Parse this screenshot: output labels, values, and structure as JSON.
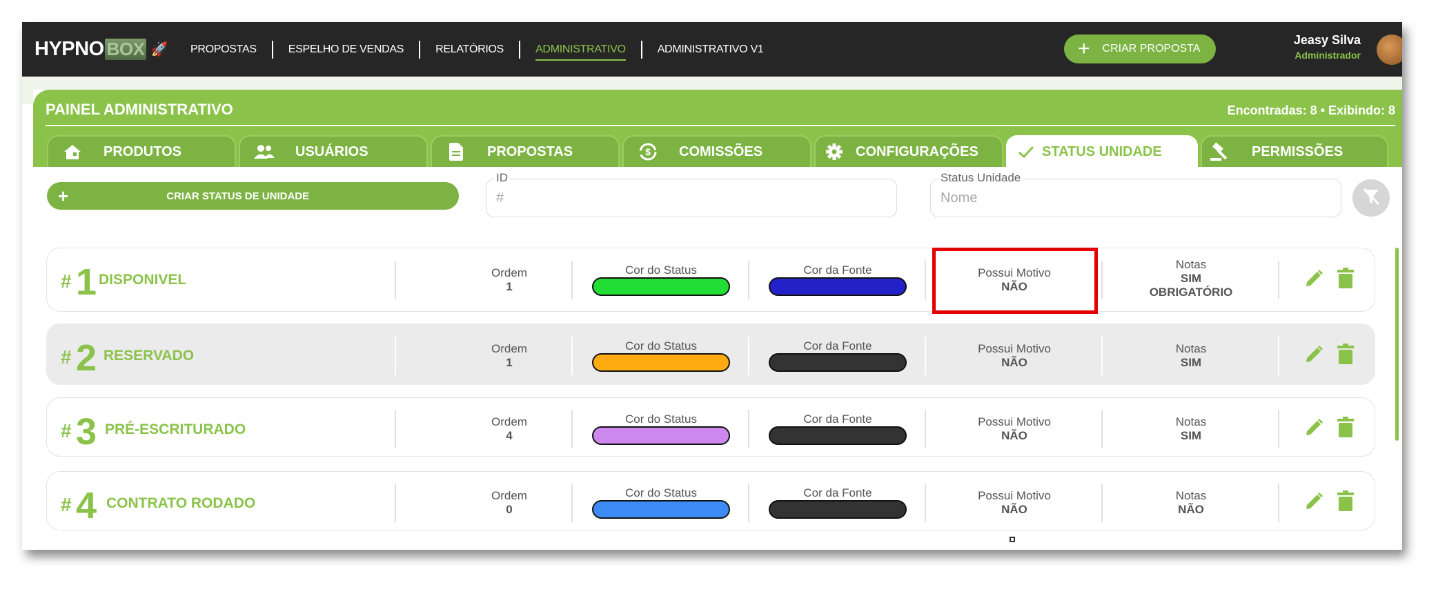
{
  "header": {
    "logo_text": "HYPNO",
    "logo_box": "BOX",
    "nav": [
      "PROPOSTAS",
      "ESPELHO DE VENDAS",
      "RELATÓRIOS",
      "ADMINISTRATIVO",
      "ADMINISTRATIVO V1"
    ],
    "active_nav": "ADMINISTRATIVO",
    "create_label": "CRIAR PROPOSTA",
    "user_name": "Jeasy Silva",
    "user_role": "Administrador"
  },
  "panel": {
    "title": "PAINEL ADMINISTRATIVO",
    "count": "Encontradas: 8 • Exibindo: 8",
    "tabs": [
      {
        "label": "PRODUTOS",
        "icon": "home-icon"
      },
      {
        "label": "USUÁRIOS",
        "icon": "users-icon"
      },
      {
        "label": "PROPOSTAS",
        "icon": "document-icon"
      },
      {
        "label": "COMISSÕES",
        "icon": "exchange-icon"
      },
      {
        "label": "CONFIGURAÇÕES",
        "icon": "gear-icon"
      },
      {
        "label": "STATUS UNIDADE",
        "icon": "check-icon"
      },
      {
        "label": "PERMISSÕES",
        "icon": "gavel-icon"
      }
    ],
    "active_tab": "STATUS UNIDADE"
  },
  "filters": {
    "create_label": "CRIAR STATUS DE UNIDADE",
    "id_label": "ID",
    "id_placeholder": "#",
    "status_label": "Status Unidade",
    "status_placeholder": "Nome"
  },
  "labels": {
    "ordem": "Ordem",
    "cor_status": "Cor do Status",
    "cor_fonte": "Cor da Fonte",
    "possui_motivo": "Possui Motivo",
    "notas": "Notas"
  },
  "rows": [
    {
      "id": "1",
      "name": "DISPONIVEL",
      "ordem": "1",
      "status_color": "#22dd33",
      "font_color": "#2222c8",
      "motivo": "NÃO",
      "notas": "SIM",
      "notas_extra": "OBRIGATÓRIO"
    },
    {
      "id": "2",
      "name": "RESERVADO",
      "ordem": "1",
      "status_color": "#ffaa11",
      "font_color": "#333333",
      "motivo": "NÃO",
      "notas": "SIM",
      "notas_extra": ""
    },
    {
      "id": "3",
      "name": "PRÉ-ESCRITURADO",
      "ordem": "4",
      "status_color": "#cc88ee",
      "font_color": "#333333",
      "motivo": "NÃO",
      "notas": "SIM",
      "notas_extra": ""
    },
    {
      "id": "4",
      "name": "CONTRATO RODADO",
      "ordem": "0",
      "status_color": "#3d8cf5",
      "font_color": "#333333",
      "motivo": "NÃO",
      "notas": "NÃO",
      "notas_extra": ""
    }
  ],
  "colors": {
    "accent": "#8bc34a",
    "highlight": "#e30000"
  }
}
